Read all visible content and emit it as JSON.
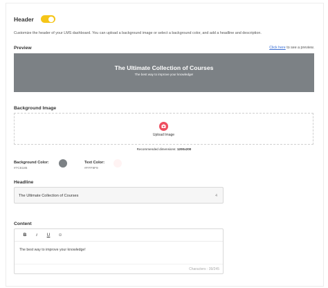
{
  "header": {
    "title": "Header",
    "toggle_on": true,
    "description": "Customize the header of your LMS dashboard. You can upload a background image or select a background color, and add a headline and description."
  },
  "preview": {
    "label": "Preview",
    "link_text": "Click here",
    "hint_suffix": " to see a preview.",
    "title": "The Ultimate Collection of Courses",
    "subtitle": "The best way to improve your knowledge!",
    "bg_color": "#7C8185"
  },
  "background_image": {
    "label": "Background Image",
    "upload_label": "Upload Image",
    "recommended_prefix": "Recommended dimensions: ",
    "recommended_value": "1200x200",
    "icon": "camera-icon"
  },
  "colors": {
    "background": {
      "label": "Background Color:",
      "value": "#7C8185",
      "swatch": "#7c8185"
    },
    "text": {
      "label": "Text Color:",
      "value": "#FFF9F9",
      "swatch": "#fff3f3"
    }
  },
  "headline": {
    "label": "Headline",
    "value": "The Ultimate Collection of Courses",
    "count": "4"
  },
  "content": {
    "label": "Content",
    "toolbar": {
      "bold": "B",
      "italic": "i",
      "underline": "U",
      "emoji": "☺"
    },
    "body": "The best way to improve your knowledge!",
    "characters": "Characters : 39/245"
  }
}
